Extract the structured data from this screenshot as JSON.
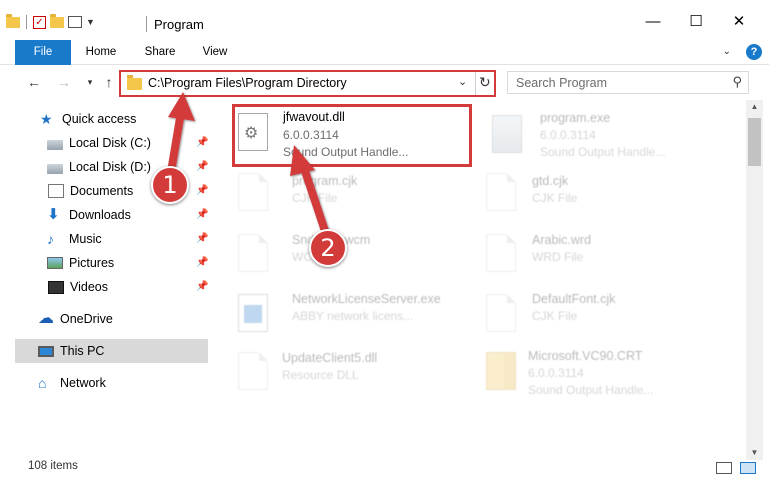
{
  "window": {
    "title": "Program",
    "minimize_glyph": "—",
    "maximize_glyph": "☐",
    "close_glyph": "✕"
  },
  "ribbon": {
    "tabs": [
      {
        "label": "File"
      },
      {
        "label": "Home"
      },
      {
        "label": "Share"
      },
      {
        "label": "View"
      }
    ],
    "help_glyph": "?"
  },
  "navigation": {
    "address_path": "C:\\Program Files\\Program Directory",
    "search_placeholder": "Search Program"
  },
  "sidebar": {
    "items": [
      {
        "label": "Quick access",
        "icon": "star-icon",
        "pinned": false
      },
      {
        "label": "Local Disk (C:)",
        "icon": "drive-icon",
        "pinned": true
      },
      {
        "label": "Local Disk (D:)",
        "icon": "drive-icon",
        "pinned": true
      },
      {
        "label": "Documents",
        "icon": "document-icon",
        "pinned": true
      },
      {
        "label": "Downloads",
        "icon": "download-icon",
        "pinned": true
      },
      {
        "label": "Music",
        "icon": "music-icon",
        "pinned": true
      },
      {
        "label": "Pictures",
        "icon": "pictures-icon",
        "pinned": true
      },
      {
        "label": "Videos",
        "icon": "videos-icon",
        "pinned": true
      },
      {
        "label": "OneDrive",
        "icon": "cloud-icon",
        "pinned": false
      },
      {
        "label": "This PC",
        "icon": "computer-icon",
        "pinned": false,
        "selected": true
      },
      {
        "label": "Network",
        "icon": "network-icon",
        "pinned": false
      }
    ]
  },
  "files": [
    {
      "name": "jfwavout.dll",
      "line1": "6.0.0.3114",
      "line2": "Sound Output Handle...",
      "icon": "dll-gear-icon",
      "highlighted": true
    },
    {
      "name": "program.exe",
      "line1": "6.0.0.3114",
      "line2": "Sound Output Handle...",
      "icon": "exe-icon"
    },
    {
      "name": "program.cjk",
      "line1": "CJK File",
      "line2": "",
      "icon": "file-icon"
    },
    {
      "name": "gtd.cjk",
      "line1": "CJK File",
      "line2": "",
      "icon": "file-icon"
    },
    {
      "name": "Snd3114.wcm",
      "line1": "WCM File",
      "line2": "",
      "icon": "file-icon"
    },
    {
      "name": "Arabic.wrd",
      "line1": "WRD File",
      "line2": "",
      "icon": "file-icon"
    },
    {
      "name": "NetworkLicenseServer.exe",
      "line1": "ABBY network licens...",
      "line2": "",
      "icon": "window-icon"
    },
    {
      "name": "DefaultFont.cjk",
      "line1": "CJK File",
      "line2": "",
      "icon": "file-icon"
    },
    {
      "name": "UpdateClient5.dll",
      "line1": "Resource DLL",
      "line2": "",
      "icon": "file-icon"
    },
    {
      "name": "Microsoft.VC90.CRT",
      "line1": "6.0.0.3114",
      "line2": "Sound Output Handle...",
      "icon": "folder-zip-icon"
    }
  ],
  "status": {
    "item_count": "108 items"
  },
  "annotations": {
    "callout_1": "1",
    "callout_2": "2",
    "color": "#d33b3b"
  },
  "colors": {
    "accent": "#1979ca",
    "annotation": "#d33b3b",
    "folder": "#f4c64a"
  }
}
